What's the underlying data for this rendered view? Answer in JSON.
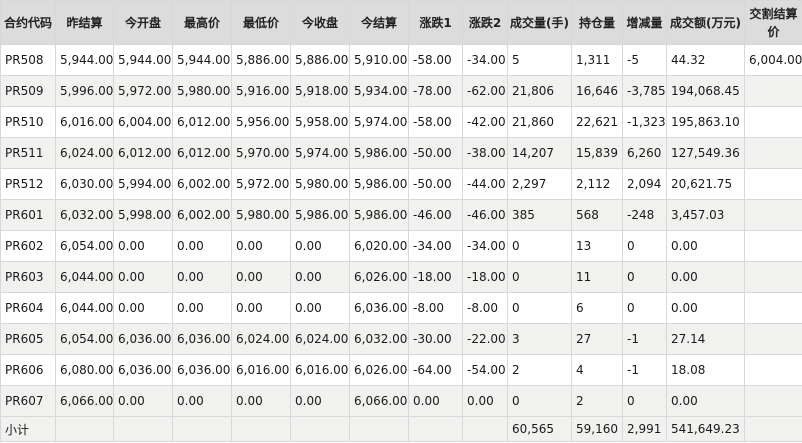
{
  "table": {
    "headers": [
      "合约代码",
      "昨结算",
      "今开盘",
      "最高价",
      "最低价",
      "今收盘",
      "今结算",
      "涨跌1",
      "涨跌2",
      "成交量(手)",
      "持仓量",
      "增减量",
      "成交额(万元)",
      "交割结算价"
    ],
    "rows": [
      [
        "PR508",
        "5,944.00",
        "5,944.00",
        "5,944.00",
        "5,886.00",
        "5,886.00",
        "5,910.00",
        "-58.00",
        "-34.00",
        "5",
        "1,311",
        "-5",
        "44.32",
        "6,004.00"
      ],
      [
        "PR509",
        "5,996.00",
        "5,972.00",
        "5,980.00",
        "5,916.00",
        "5,918.00",
        "5,934.00",
        "-78.00",
        "-62.00",
        "21,806",
        "16,646",
        "-3,785",
        "194,068.45",
        ""
      ],
      [
        "PR510",
        "6,016.00",
        "6,004.00",
        "6,012.00",
        "5,956.00",
        "5,958.00",
        "5,974.00",
        "-58.00",
        "-42.00",
        "21,860",
        "22,621",
        "-1,323",
        "195,863.10",
        ""
      ],
      [
        "PR511",
        "6,024.00",
        "6,012.00",
        "6,012.00",
        "5,970.00",
        "5,974.00",
        "5,986.00",
        "-50.00",
        "-38.00",
        "14,207",
        "15,839",
        "6,260",
        "127,549.36",
        ""
      ],
      [
        "PR512",
        "6,030.00",
        "5,994.00",
        "6,002.00",
        "5,972.00",
        "5,980.00",
        "5,986.00",
        "-50.00",
        "-44.00",
        "2,297",
        "2,112",
        "2,094",
        "20,621.75",
        ""
      ],
      [
        "PR601",
        "6,032.00",
        "5,998.00",
        "6,002.00",
        "5,980.00",
        "5,986.00",
        "5,986.00",
        "-46.00",
        "-46.00",
        "385",
        "568",
        "-248",
        "3,457.03",
        ""
      ],
      [
        "PR602",
        "6,054.00",
        "0.00",
        "0.00",
        "0.00",
        "0.00",
        "6,020.00",
        "-34.00",
        "-34.00",
        "0",
        "13",
        "0",
        "0.00",
        ""
      ],
      [
        "PR603",
        "6,044.00",
        "0.00",
        "0.00",
        "0.00",
        "0.00",
        "6,026.00",
        "-18.00",
        "-18.00",
        "0",
        "11",
        "0",
        "0.00",
        ""
      ],
      [
        "PR604",
        "6,044.00",
        "0.00",
        "0.00",
        "0.00",
        "0.00",
        "6,036.00",
        "-8.00",
        "-8.00",
        "0",
        "6",
        "0",
        "0.00",
        ""
      ],
      [
        "PR605",
        "6,054.00",
        "6,036.00",
        "6,036.00",
        "6,024.00",
        "6,024.00",
        "6,032.00",
        "-30.00",
        "-22.00",
        "3",
        "27",
        "-1",
        "27.14",
        ""
      ],
      [
        "PR606",
        "6,080.00",
        "6,036.00",
        "6,036.00",
        "6,016.00",
        "6,016.00",
        "6,026.00",
        "-64.00",
        "-54.00",
        "2",
        "4",
        "-1",
        "18.08",
        ""
      ],
      [
        "PR607",
        "6,066.00",
        "0.00",
        "0.00",
        "0.00",
        "0.00",
        "6,066.00",
        "0.00",
        "0.00",
        "0",
        "2",
        "0",
        "0.00",
        ""
      ]
    ],
    "subtotal": [
      "小计",
      "",
      "",
      "",
      "",
      "",
      "",
      "",
      "",
      "60,565",
      "59,160",
      "2,991",
      "541,649.23",
      ""
    ]
  }
}
